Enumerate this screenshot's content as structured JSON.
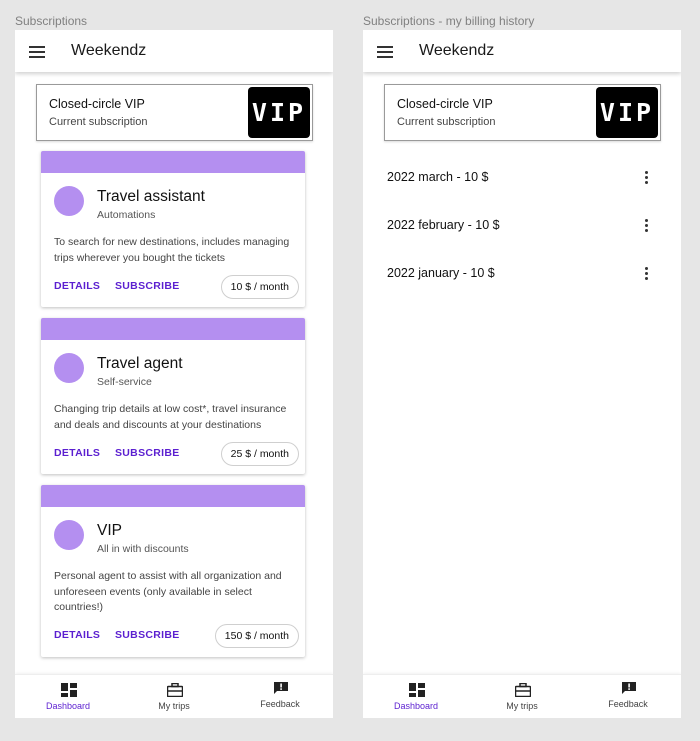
{
  "frames": {
    "left_label": "Subscriptions",
    "right_label": "Subscriptions - my billing history"
  },
  "app": {
    "title": "Weekendz",
    "menu_icon": "hamburger-menu-icon"
  },
  "current_subscription": {
    "title": "Closed-circle VIP",
    "subtitle": "Current subscription",
    "logo_text": "VIP"
  },
  "plans": [
    {
      "title": "Travel assistant",
      "subtitle": "Automations",
      "description": "To search for new destinations, includes managing trips wherever you bought the tickets",
      "details_label": "DETAILS",
      "subscribe_label": "SUBSCRIBE",
      "price": "10 $ / month"
    },
    {
      "title": "Travel agent",
      "subtitle": "Self-service",
      "description": "Changing trip details at low cost*, travel insurance and deals and discounts at your destinations",
      "details_label": "DETAILS",
      "subscribe_label": "SUBSCRIBE",
      "price": "25 $ / month"
    },
    {
      "title": "VIP",
      "subtitle": "All in with discounts",
      "description": "Personal agent to assist with all organization and unforeseen events (only available in select countries!)",
      "details_label": "DETAILS",
      "subscribe_label": "SUBSCRIBE",
      "price": "150 $ / month"
    }
  ],
  "billing_history": [
    {
      "label": "2022 march - 10 $"
    },
    {
      "label": "2022 february - 10 $"
    },
    {
      "label": "2022 january - 10 $"
    }
  ],
  "bottom_nav": [
    {
      "label": "Dashboard",
      "icon": "dashboard-icon",
      "active": true
    },
    {
      "label": "My trips",
      "icon": "briefcase-icon",
      "active": false
    },
    {
      "label": "Feedback",
      "icon": "feedback-icon",
      "active": false
    }
  ],
  "colors": {
    "accent": "#5b1fd0",
    "plan_band": "#b48ff0",
    "background": "#e6e6e6"
  }
}
